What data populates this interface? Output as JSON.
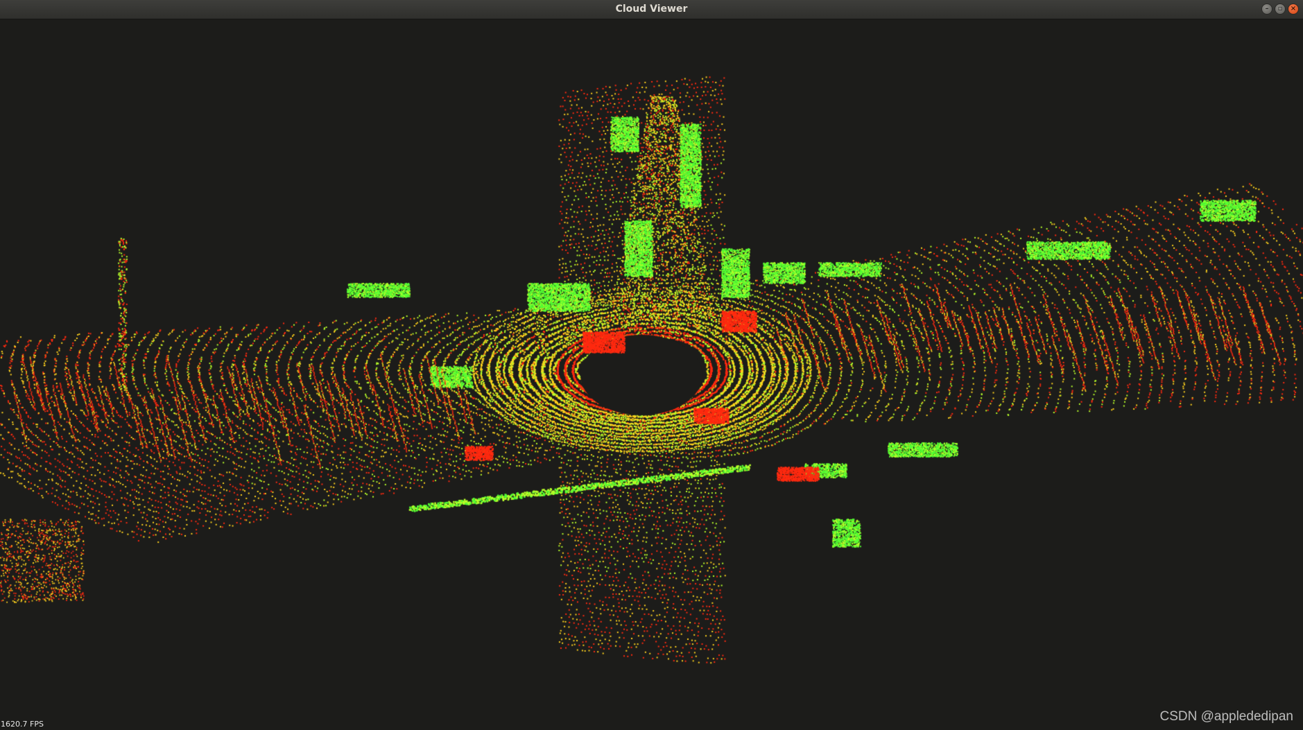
{
  "window": {
    "title": "Cloud Viewer",
    "minimize_icon": "minimize-icon",
    "maximize_icon": "maximize-icon",
    "close_icon": "close-icon"
  },
  "viewer": {
    "fps_text": "1620.7 FPS",
    "background_color": "#1c1c1a",
    "point_colors": [
      "#ff2a10",
      "#ffd21e",
      "#b8ff2a",
      "#55ff33"
    ]
  },
  "watermark": {
    "text": "CSDN @applededipan"
  }
}
